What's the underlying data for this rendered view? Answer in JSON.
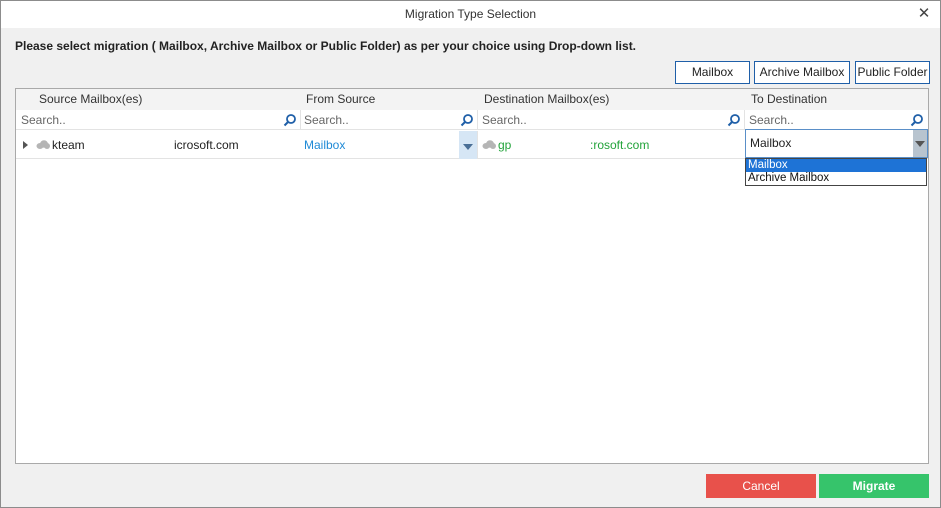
{
  "window": {
    "title": "Migration Type Selection",
    "close_symbol": "✕"
  },
  "instruction": "Please select migration ( Mailbox, Archive Mailbox or Public Folder) as per your choice using Drop-down list.",
  "toolbar": {
    "mailbox_label": "Mailbox",
    "archive_label": "Archive Mailbox",
    "public_label": "Public Folder"
  },
  "grid": {
    "columns": [
      "Source Mailbox(es)",
      "From Source",
      "Destination Mailbox(es)",
      "To Destination"
    ],
    "search_placeholders": [
      "Search..",
      "Search..",
      "Search..",
      "Search.."
    ],
    "rows": [
      {
        "source_name": "kteam",
        "source_domain": "icrosoft.com",
        "from_source": "Mailbox",
        "destination_name": "gp",
        "destination_domain": ":rosoft.com",
        "to_destination": "Mailbox"
      }
    ]
  },
  "dropdown": {
    "options": [
      "Mailbox",
      "Archive Mailbox"
    ],
    "selected_index": 0
  },
  "footer": {
    "cancel_label": "Cancel",
    "migrate_label": "Migrate"
  },
  "colors": {
    "accent_blue": "#1e73d6",
    "source_value_blue": "#1f8ad6",
    "destination_green": "#22a33a",
    "cancel_red": "#e8514b",
    "migrate_green": "#36c46b"
  },
  "icons": [
    "close-icon",
    "search-icon",
    "expand-arrow-icon",
    "cloud-icon",
    "dropdown-arrow-icon"
  ]
}
